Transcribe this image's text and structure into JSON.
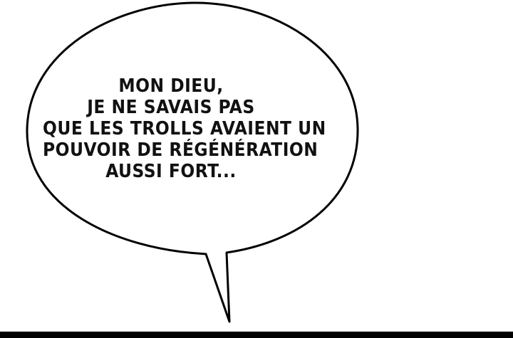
{
  "speech_bubble": {
    "lines": [
      "MON DIEU,",
      "JE NE SAVAIS PAS",
      "QUE LES TROLLS AVAIENT UN",
      "POUVOIR DE RÉGÉNÉRATION",
      "AUSSI FORT..."
    ]
  },
  "colors": {
    "background": "#ffffff",
    "ink": "#111111",
    "border": "#000000"
  }
}
